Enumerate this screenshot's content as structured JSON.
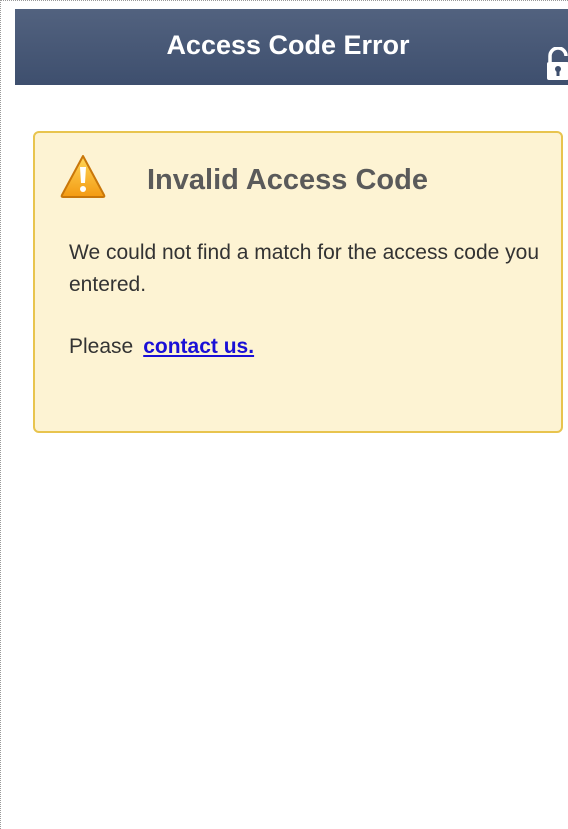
{
  "header": {
    "title": "Access Code Error",
    "lock_icon": "lock-open-icon"
  },
  "alert": {
    "icon": "warning-icon",
    "title": "Invalid Access Code",
    "message": "We could not find a match for the access code you entered.",
    "contact_prefix": "Please",
    "contact_link": "contact us."
  },
  "colors": {
    "header_bg": "#46577a",
    "alert_bg": "#fdf3d3",
    "alert_border": "#e8c44e",
    "link": "#1a0fd6"
  }
}
